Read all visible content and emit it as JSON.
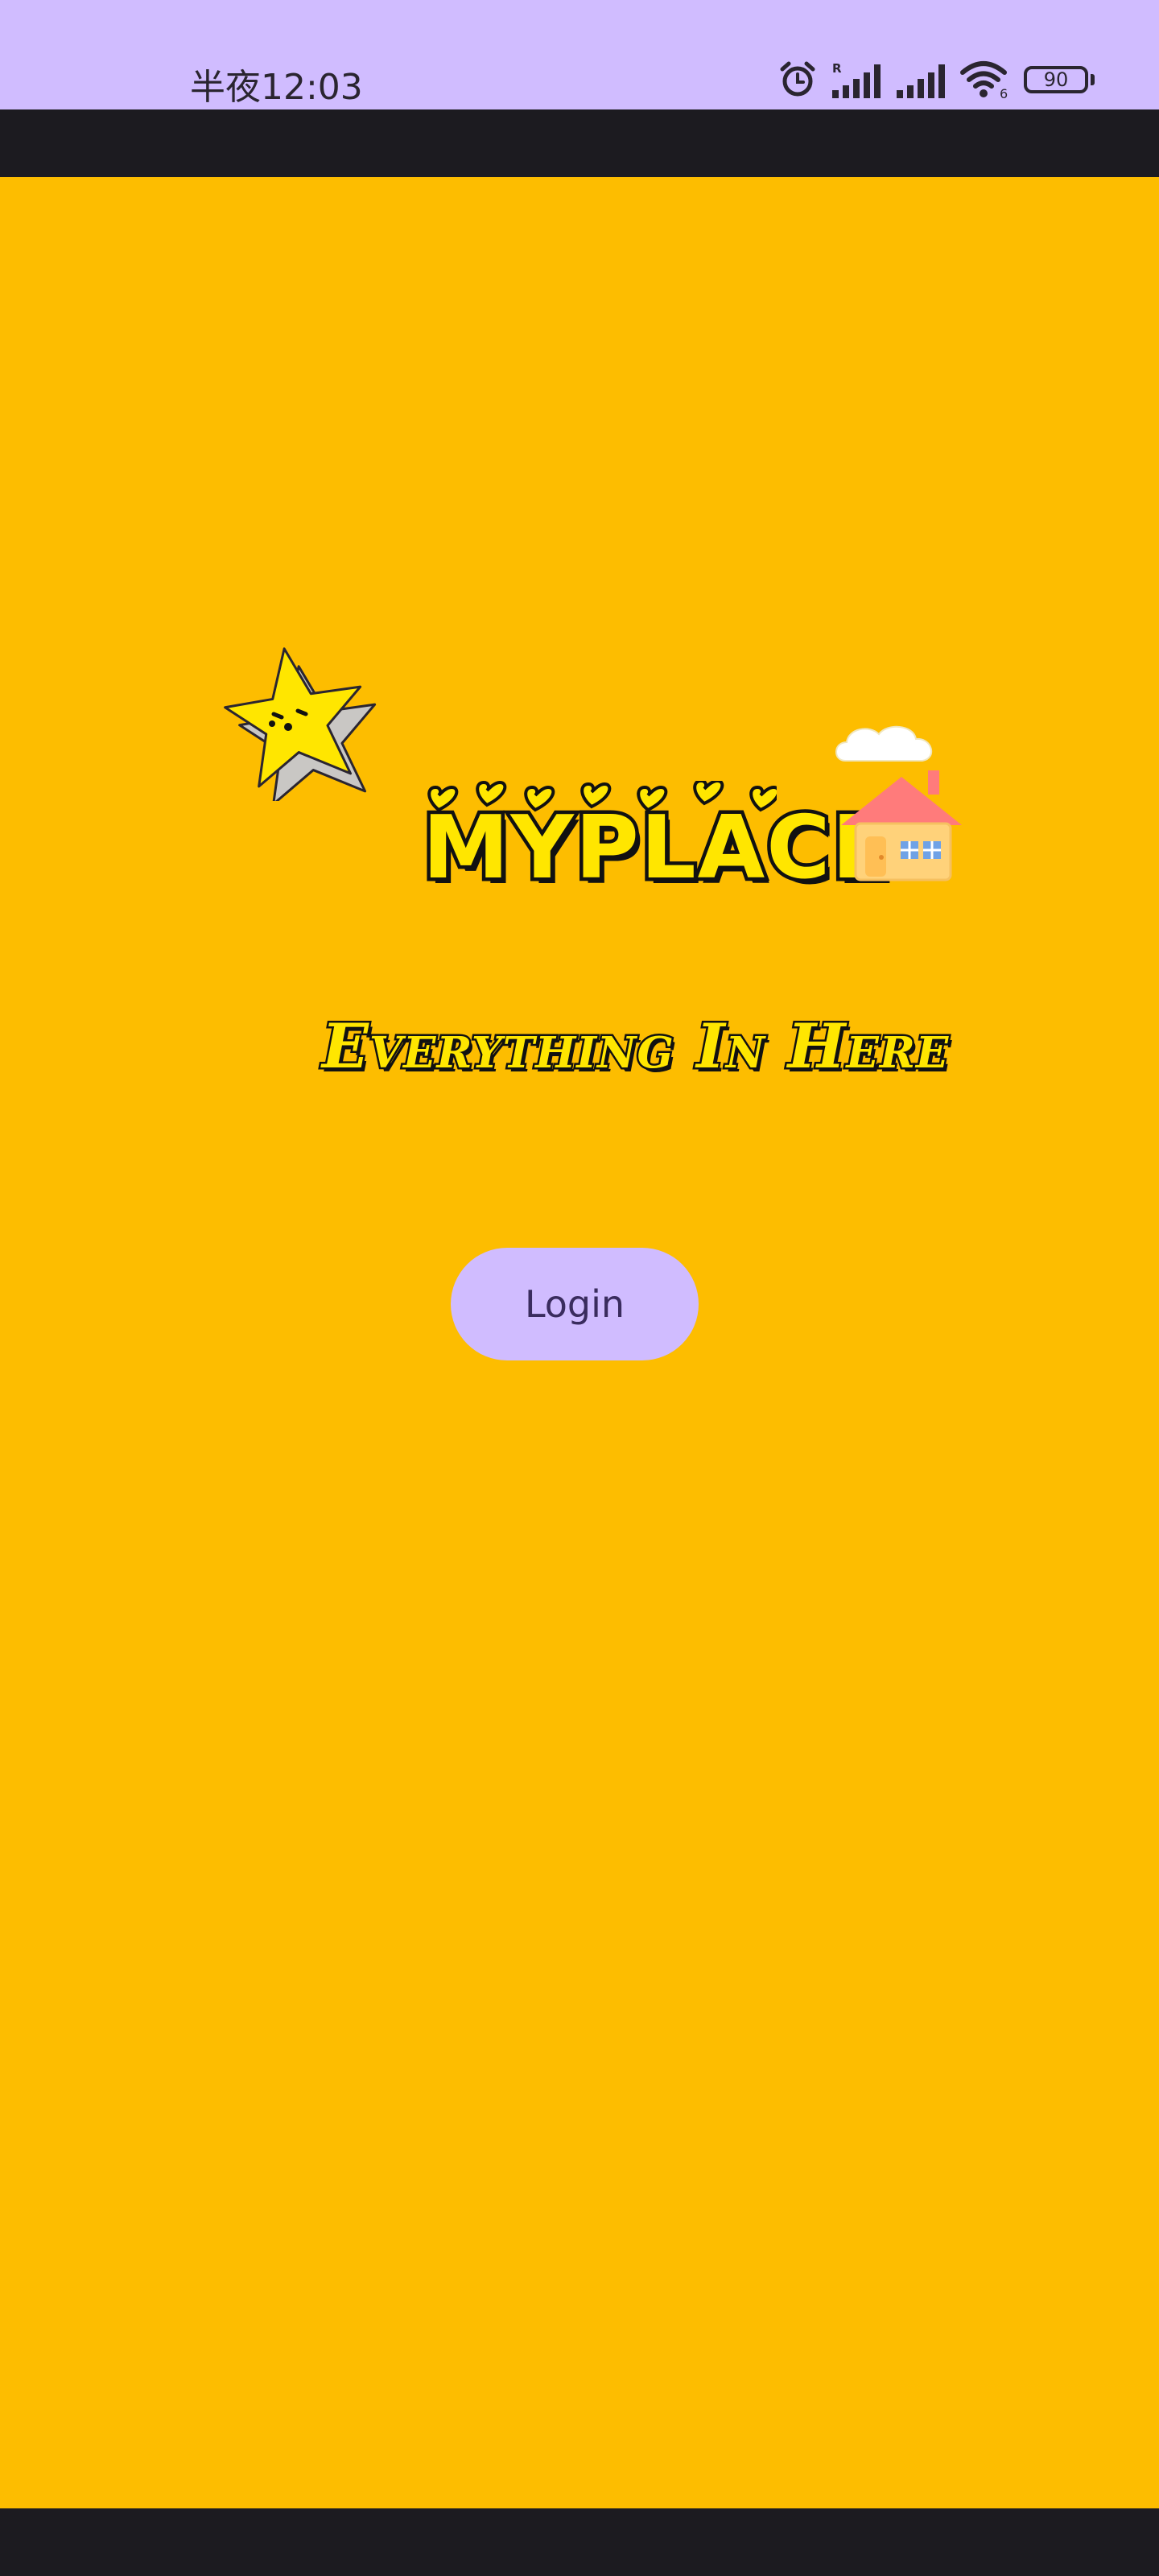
{
  "status_bar": {
    "time": "半夜12:03",
    "battery_level": "90",
    "roaming_indicator": "R",
    "wifi_badge": "6",
    "icons": [
      "alarm-icon",
      "signal-icon-1",
      "signal-icon-2",
      "wifi-icon",
      "battery-icon"
    ]
  },
  "main": {
    "logo_text": "MYPLACE",
    "tagline": "Everything In Here",
    "login_button_label": "Login",
    "decorations": [
      "star-character-icon",
      "hearts-icon",
      "house-icon",
      "cloud-icon"
    ]
  },
  "colors": {
    "status_bar": "#d0bcff",
    "background": "#fdbd00",
    "button": "#d0bcff",
    "button_text": "#3a2c5e",
    "logo_fill": "#ffe600",
    "dark_bars": "#1c1b20"
  }
}
